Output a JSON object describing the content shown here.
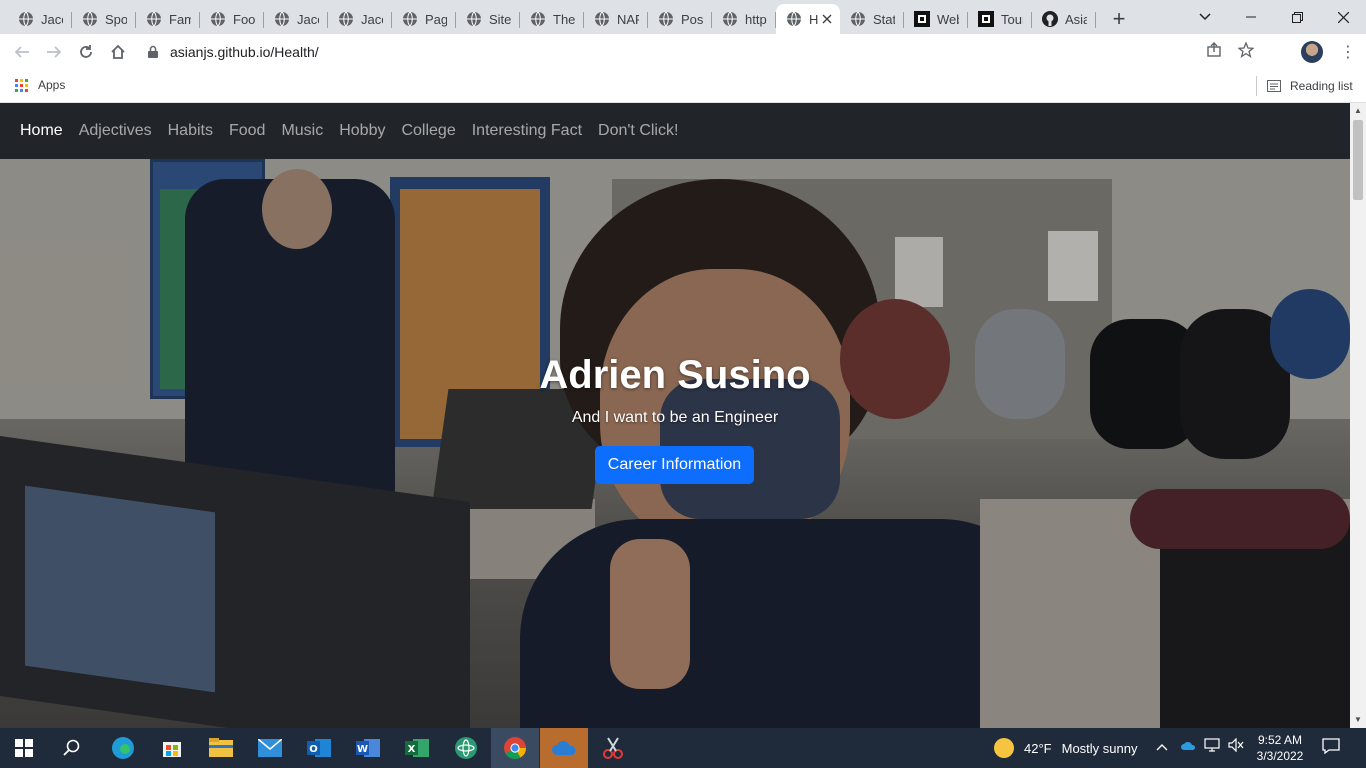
{
  "browser": {
    "tabs": [
      {
        "title": "Jaco",
        "icon": "globe-icon"
      },
      {
        "title": "Spo",
        "icon": "globe-icon"
      },
      {
        "title": "Fam",
        "icon": "globe-icon"
      },
      {
        "title": "Foo",
        "icon": "globe-icon"
      },
      {
        "title": "Jaco",
        "icon": "globe-icon"
      },
      {
        "title": "Jaco",
        "icon": "globe-icon"
      },
      {
        "title": "Page",
        "icon": "globe-icon"
      },
      {
        "title": "Site",
        "icon": "globe-icon"
      },
      {
        "title": "The",
        "icon": "globe-icon"
      },
      {
        "title": "NAP",
        "icon": "globe-icon"
      },
      {
        "title": "Post",
        "icon": "globe-icon"
      },
      {
        "title": "http",
        "icon": "globe-icon"
      },
      {
        "title": "H",
        "icon": "globe-icon",
        "active": true
      },
      {
        "title": "State",
        "icon": "globe-icon"
      },
      {
        "title": "Web",
        "icon": "black-square-icon"
      },
      {
        "title": "Tour",
        "icon": "black-square-icon"
      },
      {
        "title": "Asia",
        "icon": "github-icon"
      }
    ],
    "new_tab_label": "+",
    "url": "asianjs.github.io/Health/",
    "bookmarks": {
      "apps_label": "Apps",
      "reading_list_label": "Reading list"
    }
  },
  "site": {
    "nav": [
      {
        "label": "Home",
        "active": true
      },
      {
        "label": "Adjectives"
      },
      {
        "label": "Habits"
      },
      {
        "label": "Food"
      },
      {
        "label": "Music"
      },
      {
        "label": "Hobby"
      },
      {
        "label": "College"
      },
      {
        "label": "Interesting Fact"
      },
      {
        "label": "Don't Click!"
      }
    ],
    "hero": {
      "title": "Adrien Susino",
      "subtitle": "And I want to be an Engineer",
      "button_label": "Career Information"
    }
  },
  "taskbar": {
    "weather_temp": "42°F",
    "weather_text": "Mostly sunny",
    "time": "9:52 AM",
    "date": "3/3/2022"
  },
  "colors": {
    "navbar_bg": "#212529",
    "button_bg": "#0d6efd",
    "taskbar_bg": "#1f2a3a"
  }
}
